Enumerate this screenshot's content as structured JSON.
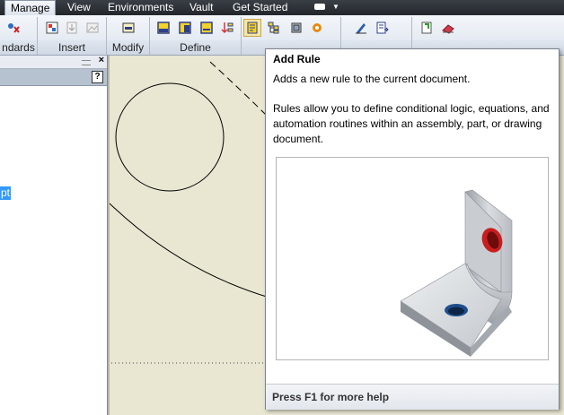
{
  "menu": {
    "tabs": [
      {
        "label": "Manage",
        "active": true
      },
      {
        "label": "View"
      },
      {
        "label": "Environments"
      },
      {
        "label": "Vault"
      },
      {
        "label": "Get Started"
      }
    ]
  },
  "ribbon": {
    "panels": [
      {
        "label": "ndards"
      },
      {
        "label": "Insert"
      },
      {
        "label": "Modify"
      },
      {
        "label": "Define"
      }
    ]
  },
  "browser": {
    "selected_text": "pt",
    "help_label": "?",
    "close_label": "×"
  },
  "tooltip": {
    "title": "Add Rule",
    "short_description": "Adds a new rule to the current document.",
    "long_description": "Rules allow you to define conditional logic, equations, and automation routines within an assembly, part, or drawing document.",
    "footer": "Press F1 for more help"
  },
  "colors": {
    "canvas_background": "#e9e7d2",
    "menubar_background": "#2c3035",
    "selection": "#3399ff",
    "hole_red": "#c81e1e",
    "hole_blue": "#1f4f8a"
  }
}
